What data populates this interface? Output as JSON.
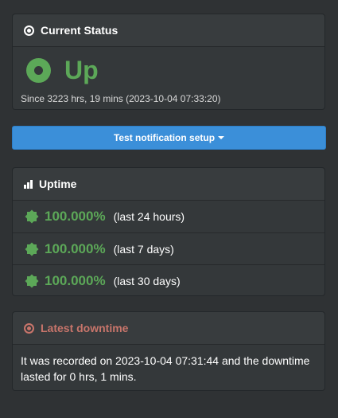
{
  "current_status": {
    "title": "Current Status",
    "state": "Up",
    "since": "Since 3223 hrs, 19 mins (2023-10-04 07:33:20)",
    "state_color": "#5ca858"
  },
  "notify_button": {
    "label": "Test notification setup"
  },
  "uptime": {
    "title": "Uptime",
    "rows": [
      {
        "percent": "100.000%",
        "period": "(last 24 hours)"
      },
      {
        "percent": "100.000%",
        "period": "(last 7 days)"
      },
      {
        "percent": "100.000%",
        "period": "(last 30 days)"
      }
    ]
  },
  "downtime": {
    "title": "Latest downtime",
    "text": "It was recorded on 2023-10-04 07:31:44 and the downtime lasted for 0 hrs, 1 mins.",
    "color": "#c8756b"
  }
}
